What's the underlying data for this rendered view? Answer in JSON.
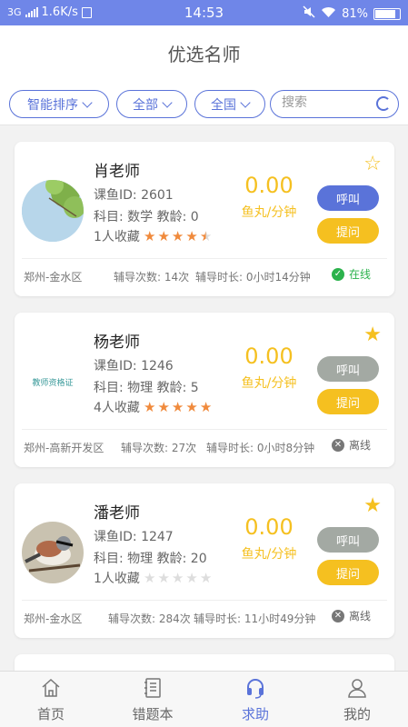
{
  "status_bar": {
    "network": "3G",
    "speed": "1.6K/s",
    "time": "14:53",
    "battery": "81%"
  },
  "header": {
    "title": "优选名师"
  },
  "filters": {
    "sort": "智能排序",
    "subject": "全部",
    "region": "全国",
    "search_placeholder": "搜索"
  },
  "teachers": [
    {
      "name": "肖老师",
      "id_line": "课鱼ID: 2601",
      "subject_line": "科目: 数学   教龄: 0",
      "favorites": "1人收藏",
      "rating": 4.5,
      "price": "0.00",
      "unit": "鱼丸/分钟",
      "favorited": false,
      "call_label": "呼叫",
      "ask_label": "提问",
      "call_enabled": true,
      "location": "郑州-金水区",
      "sessions": "辅导次数: 14次",
      "duration": "辅导时长: 0小时14分钟",
      "online_status": "在线",
      "online": true,
      "avatar": "tree-photo"
    },
    {
      "name": "杨老师",
      "id_line": "课鱼ID: 1246",
      "subject_line": "科目: 物理   教龄: 5",
      "favorites": "4人收藏",
      "rating": 5,
      "price": "0.00",
      "unit": "鱼丸/分钟",
      "favorited": true,
      "call_label": "呼叫",
      "ask_label": "提问",
      "call_enabled": false,
      "location": "郑州-高新开发区",
      "sessions": "辅导次数: 27次",
      "duration": "辅导时长: 0小时8分钟",
      "online_status": "离线",
      "online": false,
      "avatar_text": "教师资格证"
    },
    {
      "name": "潘老师",
      "id_line": "课鱼ID: 1247",
      "subject_line": "科目: 物理   教龄: 20",
      "favorites": "1人收藏",
      "rating": 0,
      "price": "0.00",
      "unit": "鱼丸/分钟",
      "favorited": true,
      "call_label": "呼叫",
      "ask_label": "提问",
      "call_enabled": false,
      "location": "郑州-金水区",
      "sessions": "辅导次数: 284次",
      "duration": "辅导时长: 11小时49分钟",
      "online_status": "离线",
      "online": false,
      "avatar": "bird-photo"
    }
  ],
  "tabbar": {
    "tabs": [
      {
        "label": "首页",
        "icon": "home-icon",
        "active": false
      },
      {
        "label": "错题本",
        "icon": "notebook-icon",
        "active": false
      },
      {
        "label": "求助",
        "icon": "headset-icon",
        "active": true
      },
      {
        "label": "我的",
        "icon": "user-icon",
        "active": false
      }
    ]
  },
  "colors": {
    "accent": "#5a73d9",
    "status_bar": "#6f86e8",
    "price": "#f5c020",
    "call_active": "#5a73d9",
    "call_disabled": "#a3a9a3",
    "ask": "#f5c020",
    "star": "#f08a3c",
    "online": "#2bb24c"
  }
}
